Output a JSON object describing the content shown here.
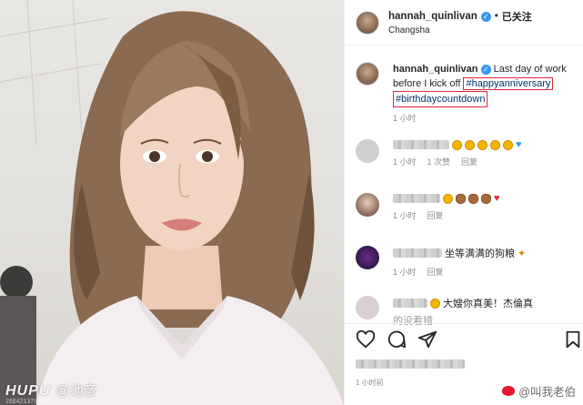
{
  "post": {
    "username": "hannah_quinlivan",
    "follow_status": "已关注",
    "location": "Changsha"
  },
  "caption": {
    "username": "hannah_quinlivan",
    "text": "Last day of work before I kick off",
    "tag1": "#happyanniversary",
    "tag2": "#birthdaycountdown",
    "time": "1 小时"
  },
  "comments": [
    {
      "text": "",
      "time": "1 小时",
      "likes": "1 次赞",
      "reply": "回复"
    },
    {
      "text": "",
      "time": "1 小时",
      "reply": "回复"
    },
    {
      "text": "坐等满满的狗粮",
      "time": "1 小时",
      "reply": "回复"
    },
    {
      "text": "大嫂你真美！杰倫真",
      "text2": "的没看错",
      "time": "",
      "reply": ""
    }
  ],
  "footer": {
    "time": "1 小时前"
  },
  "watermarks": {
    "site": "HUPU",
    "user": "@池彦",
    "weibo": "@叫我老伯",
    "serial": "2664213799797"
  },
  "colors": {
    "link": "#003569",
    "highlight_box": "#e0243a",
    "verified": "#3897f0"
  },
  "icons": [
    "heart-icon",
    "comment-icon",
    "share-icon",
    "bookmark-icon",
    "verified-icon"
  ]
}
